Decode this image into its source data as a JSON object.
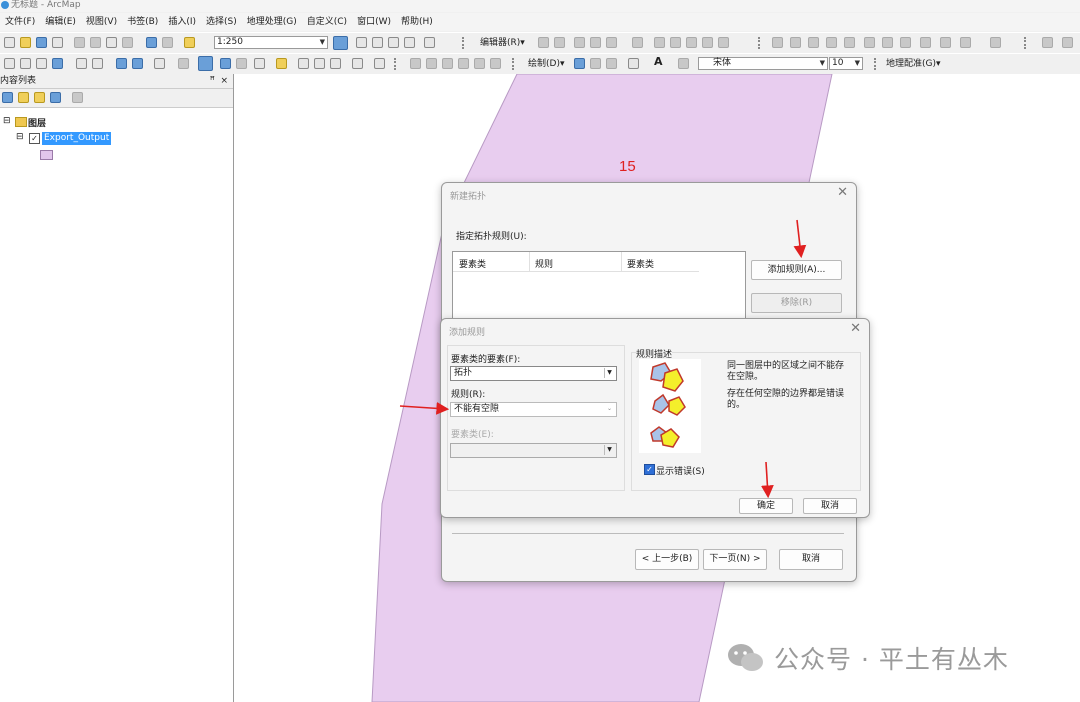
{
  "window": {
    "title": "无标题 - ArcMap"
  },
  "menu": [
    "文件(F)",
    "编辑(E)",
    "视图(V)",
    "书签(B)",
    "插入(I)",
    "选择(S)",
    "地理处理(G)",
    "自定义(C)",
    "窗口(W)",
    "帮助(H)"
  ],
  "toolbar": {
    "scale": "1:250",
    "editor_label": "编辑器(R)▾",
    "draw_label": "绘制(D)▾",
    "font_name": "宋体",
    "font_size": "10",
    "georef_label": "地理配准(G)▾",
    "text_tool": "A"
  },
  "toc": {
    "title": "内容列表",
    "pin": "ꟸ",
    "close": "×",
    "layers_label": "图层",
    "layer_name": "Export_Output",
    "expand_minus": "⊟",
    "check": "✓",
    "symbol_color": "#e2c6ec"
  },
  "map": {
    "annotation": "15",
    "polygon_color": "#e8cdef"
  },
  "new_topology_dialog": {
    "title": "新建拓扑",
    "close": "✕",
    "rules_label": "指定拓扑规则(U):",
    "columns": [
      "要素类",
      "规则",
      "要素类"
    ],
    "add_rule_button": "添加规则(A)...",
    "remove_button": "移除(R)",
    "back_button": "< 上一步(B)",
    "next_button": "下一页(N) >",
    "cancel_button": "取消"
  },
  "add_rule_dialog": {
    "title": "添加规则",
    "close": "✕",
    "feature_label": "要素类的要素(F):",
    "feature_value": "拓扑",
    "rule_label": "规则(R):",
    "rule_value": "不能有空隙",
    "feature_class_label": "要素类(E):",
    "feature_class_value": "",
    "desc_title": "规则描述",
    "desc_text_1": "同一图层中的区域之间不能存在空隙。",
    "desc_text_2": "存在任何空隙的边界都是错误的。",
    "show_errors_label": "显示错误(S)",
    "ok_button": "确定",
    "cancel_button": "取消"
  },
  "watermark": {
    "text": "公众号 · 平土有丛木"
  },
  "colors": {
    "accent_arrow": "#e02020",
    "selected_layer_bg": "#3399ff"
  }
}
